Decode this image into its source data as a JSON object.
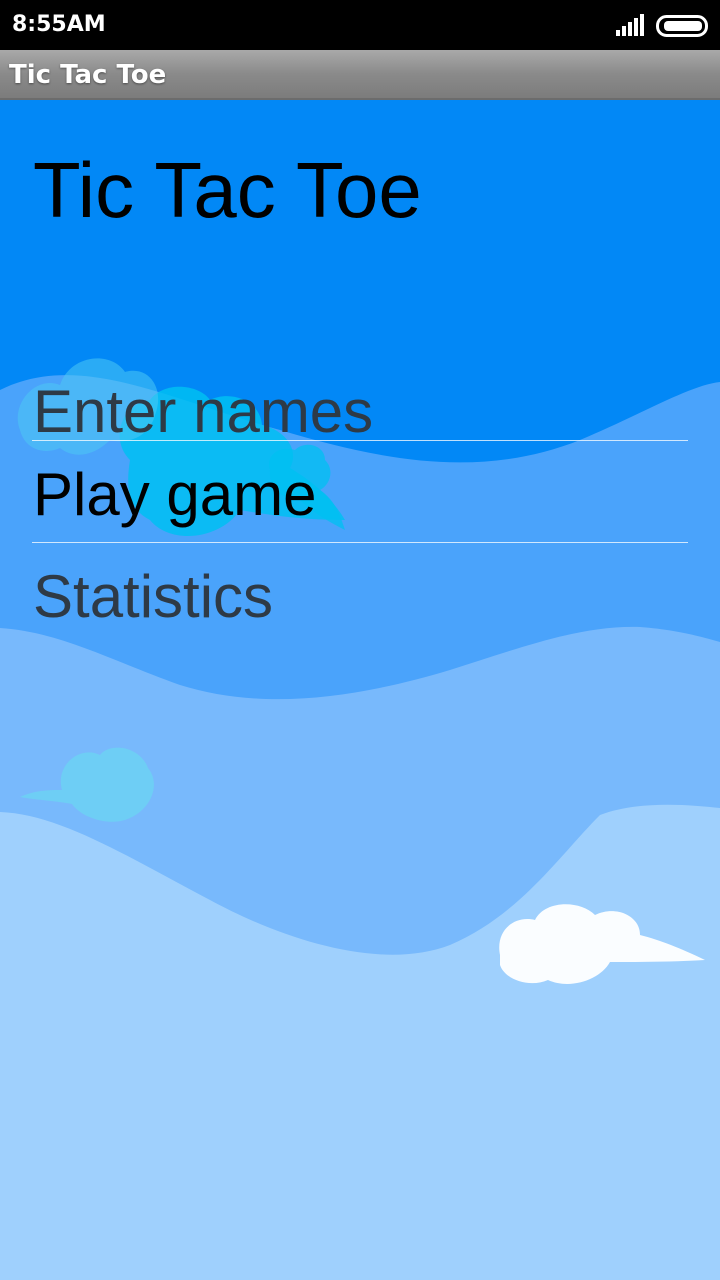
{
  "status_bar": {
    "time": "8:55AM",
    "signal_icon": "signal-bars-icon",
    "battery_icon": "battery-icon"
  },
  "action_bar": {
    "title": "Tic Tac Toe"
  },
  "main": {
    "title": "Tic Tac Toe",
    "menu": [
      {
        "label": "Enter names"
      },
      {
        "label": "Play game"
      },
      {
        "label": "Statistics"
      }
    ]
  },
  "colors": {
    "sky_top": "#0288f6",
    "wave_mid": "#4aa3fb",
    "wave_light": "#78b9fc",
    "wave_lightest": "#9fd0fd",
    "cloud_cyan": "#00c0f2",
    "cloud_white": "#ffffff"
  }
}
